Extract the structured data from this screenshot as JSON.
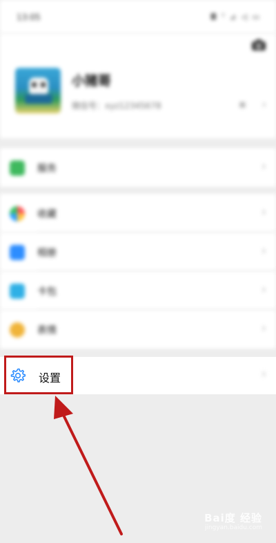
{
  "status_bar": {
    "time": "13:05",
    "indicators": "◘ ᵀ ⊿ ◁ ▭"
  },
  "profile": {
    "name": "小猪哥",
    "id_text": "微信号：xyz12345678",
    "qr_label": "⊞",
    "chevron": "›"
  },
  "menu": {
    "pay": {
      "label": "服务",
      "icon": "wallet-icon",
      "chevron": "›"
    },
    "favorites": {
      "label": "收藏",
      "icon": "favorites-icon",
      "chevron": "›"
    },
    "album": {
      "label": "相册",
      "icon": "album-icon",
      "chevron": "›"
    },
    "cards": {
      "label": "卡包",
      "icon": "cards-icon",
      "chevron": "›"
    },
    "stickers": {
      "label": "表情",
      "icon": "sticker-icon",
      "chevron": "›"
    },
    "settings": {
      "label": "设置",
      "icon": "gear-icon",
      "chevron": "›"
    }
  },
  "annotation": {
    "color": "#c01b1b"
  },
  "watermark": {
    "brand": "Bai度 经验",
    "url": "jingyan.baidu.com"
  },
  "colors": {
    "accent": "#2d8dff",
    "background": "#ededed"
  }
}
